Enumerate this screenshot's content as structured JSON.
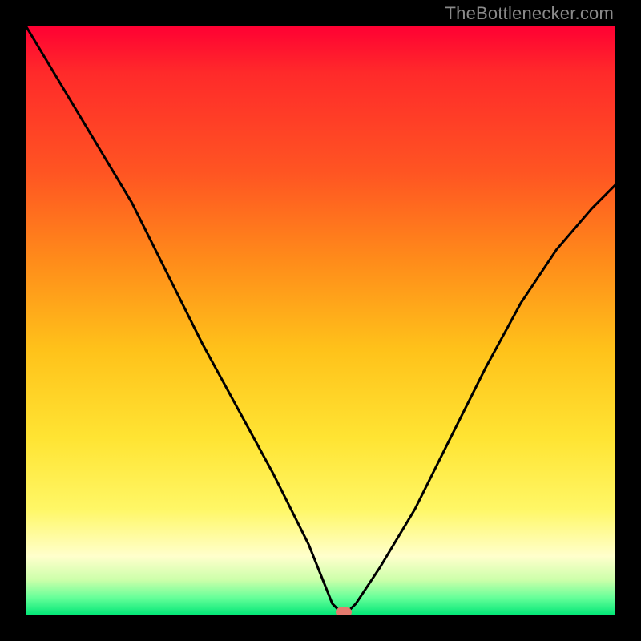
{
  "watermark": "TheBottlenecker.com",
  "marker": {
    "x_pct": 54,
    "y_pct": 100
  },
  "chart_data": {
    "type": "line",
    "title": "",
    "xlabel": "",
    "ylabel": "",
    "xlim": [
      0,
      100
    ],
    "ylim": [
      0,
      100
    ],
    "series": [
      {
        "name": "bottleneck-curve",
        "x": [
          0,
          6,
          12,
          18,
          24,
          30,
          36,
          42,
          48,
          52,
          54,
          56,
          60,
          66,
          72,
          78,
          84,
          90,
          96,
          100
        ],
        "y": [
          100,
          90,
          80,
          70,
          58,
          46,
          35,
          24,
          12,
          2,
          0,
          2,
          8,
          18,
          30,
          42,
          53,
          62,
          69,
          73
        ]
      }
    ],
    "gradient_stops": [
      {
        "pct": 0,
        "color": "#ff0033"
      },
      {
        "pct": 25,
        "color": "#ff5522"
      },
      {
        "pct": 55,
        "color": "#ffc21a"
      },
      {
        "pct": 82,
        "color": "#fff766"
      },
      {
        "pct": 100,
        "color": "#00e676"
      }
    ]
  }
}
